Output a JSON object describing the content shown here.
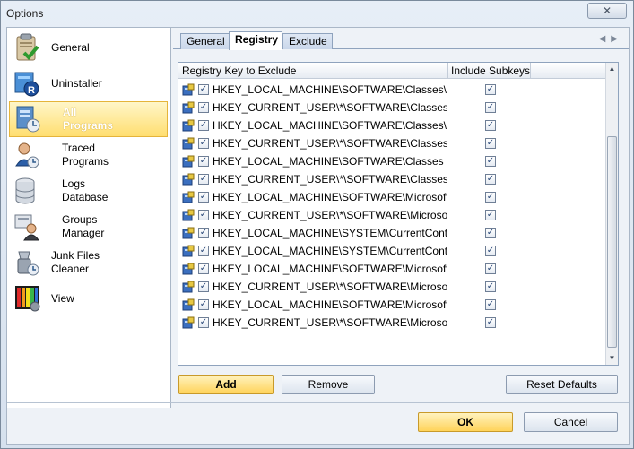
{
  "window": {
    "title": "Options",
    "close_label": "✕"
  },
  "sidebar": {
    "items": [
      {
        "label": "General",
        "icon": "clipboard-check-icon"
      },
      {
        "label": "Uninstaller",
        "icon": "uninstaller-icon"
      },
      {
        "label": "All\nPrograms",
        "icon": "all-programs-icon"
      },
      {
        "label": "Traced\nPrograms",
        "icon": "traced-programs-icon"
      },
      {
        "label": "Logs\nDatabase",
        "icon": "database-icon"
      },
      {
        "label": "Groups\nManager",
        "icon": "groups-manager-icon"
      },
      {
        "label": "Junk Files\nCleaner",
        "icon": "junk-cleaner-icon"
      },
      {
        "label": "View",
        "icon": "view-icon"
      }
    ],
    "selected_index": 2
  },
  "tabs": [
    {
      "label": "General"
    },
    {
      "label": "Registry"
    },
    {
      "label": "Exclude"
    }
  ],
  "active_tab": "Registry",
  "grid": {
    "columns": [
      "Registry Key to Exclude",
      "Include Subkeys"
    ],
    "rows": [
      {
        "key": "HKEY_LOCAL_MACHINE\\SOFTWARE\\Classes\\In...",
        "checked": true,
        "subkeys": true
      },
      {
        "key": "HKEY_CURRENT_USER\\*\\SOFTWARE\\Classes\\In...",
        "checked": true,
        "subkeys": true
      },
      {
        "key": "HKEY_LOCAL_MACHINE\\SOFTWARE\\Classes\\A...",
        "checked": true,
        "subkeys": true
      },
      {
        "key": "HKEY_CURRENT_USER\\*\\SOFTWARE\\Classes\\A...",
        "checked": true,
        "subkeys": true
      },
      {
        "key": "HKEY_LOCAL_MACHINE\\SOFTWARE\\Classes",
        "checked": true,
        "subkeys": true
      },
      {
        "key": "HKEY_CURRENT_USER\\*\\SOFTWARE\\Classes",
        "checked": true,
        "subkeys": true
      },
      {
        "key": "HKEY_LOCAL_MACHINE\\SOFTWARE\\Microsoft...",
        "checked": true,
        "subkeys": true
      },
      {
        "key": "HKEY_CURRENT_USER\\*\\SOFTWARE\\Microsoft\\...",
        "checked": true,
        "subkeys": true
      },
      {
        "key": "HKEY_LOCAL_MACHINE\\SYSTEM\\CurrentContr...",
        "checked": true,
        "subkeys": true
      },
      {
        "key": "HKEY_LOCAL_MACHINE\\SYSTEM\\CurrentContr...",
        "checked": true,
        "subkeys": true
      },
      {
        "key": "HKEY_LOCAL_MACHINE\\SOFTWARE\\Microsoft...",
        "checked": true,
        "subkeys": true
      },
      {
        "key": "HKEY_CURRENT_USER\\*\\SOFTWARE\\Microsoft\\...",
        "checked": true,
        "subkeys": true
      },
      {
        "key": "HKEY_LOCAL_MACHINE\\SOFTWARE\\Microsoft...",
        "checked": true,
        "subkeys": true
      },
      {
        "key": "HKEY_CURRENT_USER\\*\\SOFTWARE\\Microsoft\\...",
        "checked": true,
        "subkeys": true
      }
    ]
  },
  "buttons": {
    "add": "Add",
    "remove": "Remove",
    "reset_defaults": "Reset Defaults",
    "ok": "OK",
    "cancel": "Cancel"
  },
  "colors": {
    "selected_item": "#ffde70",
    "primary_button": "#ffd35a"
  }
}
